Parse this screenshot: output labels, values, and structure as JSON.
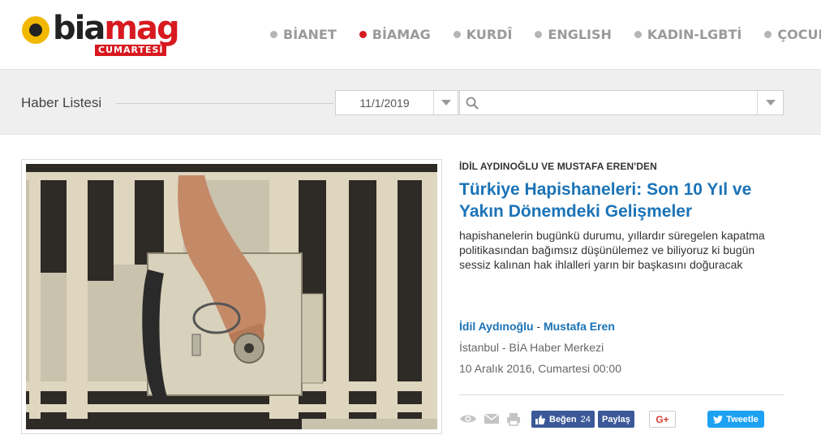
{
  "brand": {
    "word_left": "bia",
    "word_right": "mag",
    "subtitle": "CUMARTESİ",
    "accent_color": "#d71920"
  },
  "nav": {
    "items": [
      {
        "label": "BİANET",
        "active": false
      },
      {
        "label": "BİAMAG",
        "active": true
      },
      {
        "label": "KURDÎ",
        "active": false
      },
      {
        "label": "ENGLISH",
        "active": false
      },
      {
        "label": "KADIN-LGBTİ",
        "active": false
      },
      {
        "label": "ÇOCUK",
        "active": false
      }
    ]
  },
  "filter": {
    "label": "Haber Listesi",
    "date_value": "11/1/2019",
    "search_value": ""
  },
  "article": {
    "kicker": "İDİL AYDINOĞLU VE MUSTAFA EREN'DEN",
    "title": "Türkiye Hapishaneleri: Son 10 Yıl ve Yakın Dönemdeki Gelişmeler",
    "summary": "hapishanelerin bugünkü durumu, yıllardır süregelen kapatma politikasından bağımsız düşünülemez ve biliyoruz ki bugün sessiz kalınan hak ihlalleri yarın bir başkasını doğuracak",
    "author_1": "İdil Aydınoğlu",
    "author_sep": " - ",
    "author_2": "Mustafa Eren",
    "location": "İstanbul - BİA Haber Merkezi",
    "date": "10 Aralık 2016, Cumartesi 00:00"
  },
  "actions": {
    "fb_like_label": "Beğen",
    "fb_like_count": "24",
    "fb_share_label": "Paylaş",
    "gplus_label": "G+",
    "tweet_label": "Tweetle",
    "icons": [
      "eye-icon",
      "mail-icon",
      "print-icon"
    ]
  }
}
